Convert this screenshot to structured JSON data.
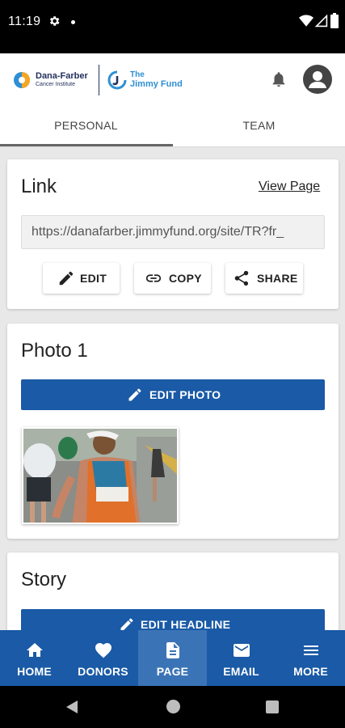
{
  "status_bar": {
    "time": "11:19"
  },
  "header": {
    "logo_primary": {
      "line1": "Dana-Farber",
      "line2": "Cancer Institute"
    },
    "logo_secondary": {
      "line1": "The",
      "line2": "Jimmy Fund"
    }
  },
  "tabs": [
    {
      "label": "PERSONAL",
      "active": true
    },
    {
      "label": "TEAM",
      "active": false
    }
  ],
  "link_card": {
    "title": "Link",
    "view_page_label": "View Page",
    "url_value": "https://danafarber.jimmyfund.org/site/TR?fr_",
    "buttons": {
      "edit": "EDIT",
      "copy": "COPY",
      "share": "SHARE"
    }
  },
  "photo_card": {
    "title": "Photo 1",
    "edit_photo_label": "EDIT PHOTO"
  },
  "story_card": {
    "title": "Story",
    "edit_headline_label": "EDIT HEADLINE"
  },
  "bottom_nav": [
    {
      "label": "HOME",
      "icon": "home-icon",
      "active": false
    },
    {
      "label": "DONORS",
      "icon": "heart-icon",
      "active": false
    },
    {
      "label": "PAGE",
      "icon": "document-icon",
      "active": true
    },
    {
      "label": "EMAIL",
      "icon": "mail-icon",
      "active": false
    },
    {
      "label": "MORE",
      "icon": "menu-icon",
      "active": false
    }
  ],
  "colors": {
    "primary_blue": "#1a5aa6",
    "active_nav": "#3b74b6",
    "background": "#e8e8e8"
  }
}
